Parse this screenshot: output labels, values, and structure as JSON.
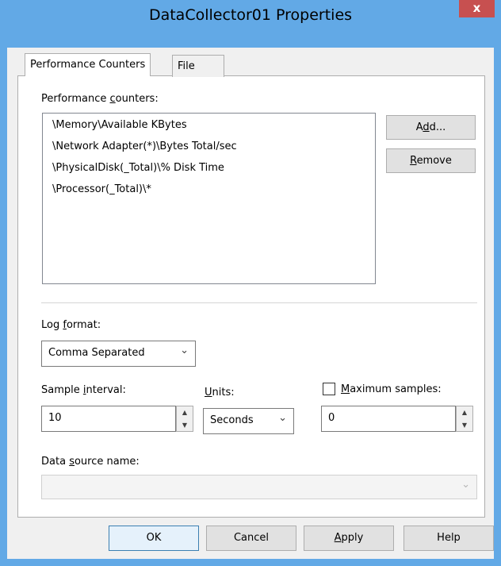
{
  "window": {
    "title": "DataCollector01 Properties",
    "close_glyph": "x"
  },
  "tabs": [
    {
      "label": "Performance Counters",
      "active": true
    },
    {
      "label": "File",
      "active": false
    }
  ],
  "counters": {
    "label_pre": "Performance ",
    "label_key": "c",
    "label_post": "ounters:",
    "items": [
      "\\Memory\\Available KBytes",
      "\\Network Adapter(*)\\Bytes Total/sec",
      "\\PhysicalDisk(_Total)\\% Disk Time",
      "\\Processor(_Total)\\*"
    ],
    "add_pre": "A",
    "add_key": "d",
    "add_post": "d...",
    "remove_pre": "",
    "remove_key": "R",
    "remove_post": "emove"
  },
  "log_format": {
    "label_pre": "Log ",
    "label_key": "f",
    "label_post": "ormat:",
    "value": "Comma Separated"
  },
  "sample_interval": {
    "label_pre": "Sample ",
    "label_key": "i",
    "label_post": "nterval:",
    "value": "10"
  },
  "units": {
    "label_pre": "",
    "label_key": "U",
    "label_post": "nits:",
    "value": "Seconds"
  },
  "max_samples": {
    "label_pre": "",
    "label_key": "M",
    "label_post": "aximum samples:",
    "value": "0",
    "checked": false
  },
  "data_source": {
    "label_pre": "Data ",
    "label_key": "s",
    "label_post": "ource name:",
    "value": ""
  },
  "footer": {
    "ok": "OK",
    "cancel": "Cancel",
    "apply_pre": "",
    "apply_key": "A",
    "apply_post": "pply",
    "help": "Help"
  },
  "icons": {
    "chevron_down": "⌄",
    "spin_up": "▲",
    "spin_down": "▼"
  },
  "colors": {
    "titlebar": "#62a9e6",
    "close_button": "#c75050",
    "dialog_bg": "#f0f0f0"
  }
}
